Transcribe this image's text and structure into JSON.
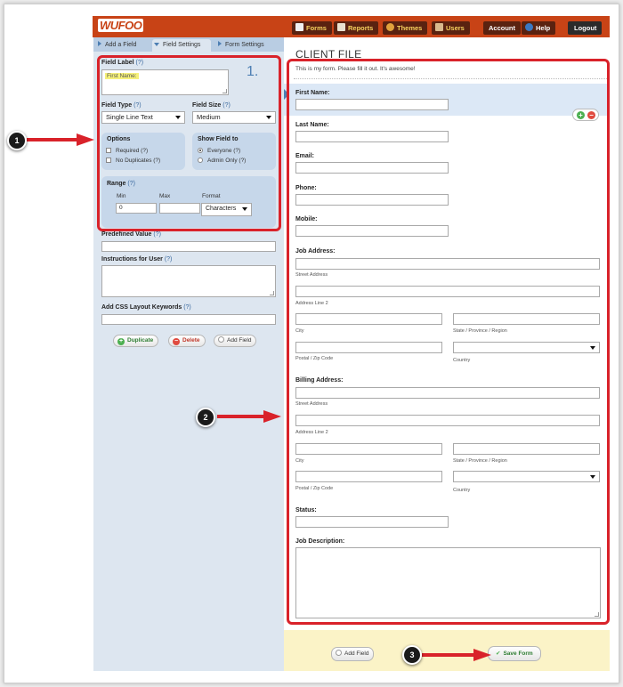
{
  "app": {
    "logo": "WUFOO"
  },
  "nav": {
    "items": [
      {
        "label": "Forms",
        "icon": "forms-icon"
      },
      {
        "label": "Reports",
        "icon": "reports-icon"
      },
      {
        "label": "Themes",
        "icon": "themes-icon"
      },
      {
        "label": "Users",
        "icon": "users-icon"
      }
    ],
    "account": "Account",
    "help": "Help",
    "logout": "Logout"
  },
  "tabs": {
    "add_field": "Add a Field",
    "field_settings": "Field Settings",
    "form_settings": "Form Settings"
  },
  "field_settings": {
    "number": "1.",
    "field_label": {
      "label": "Field Label",
      "help": "(?)",
      "value": "First Name:"
    },
    "field_type": {
      "label": "Field Type",
      "help": "(?)",
      "value": "Single Line Text"
    },
    "field_size": {
      "label": "Field Size",
      "help": "(?)",
      "value": "Medium"
    },
    "options": {
      "label": "Options",
      "required": "Required (?)",
      "no_duplicates": "No Duplicates (?)"
    },
    "show_field": {
      "label": "Show Field to",
      "everyone": "Everyone (?)",
      "admin_only": "Admin Only (?)"
    },
    "range": {
      "label": "Range",
      "help": "(?)",
      "min_label": "Min",
      "max_label": "Max",
      "format_label": "Format",
      "min_value": "0",
      "max_value": "",
      "format_value": "Characters"
    },
    "predefined": {
      "label": "Predefined Value",
      "help": "(?)"
    },
    "instructions": {
      "label": "Instructions for User",
      "help": "(?)"
    },
    "css": {
      "label": "Add CSS Layout Keywords",
      "help": "(?)"
    },
    "buttons": {
      "duplicate": "Duplicate",
      "delete": "Delete",
      "add_field": "Add Field"
    }
  },
  "form": {
    "title": "CLIENT FILE",
    "description": "This is my form. Please fill it out. It's awesome!",
    "first_name": "First Name:",
    "last_name": "Last Name:",
    "email": "Email:",
    "phone": "Phone:",
    "mobile": "Mobile:",
    "job_address": "Job Address:",
    "billing_address": "Billing Address:",
    "street": "Street Address",
    "line2": "Address Line 2",
    "city": "City",
    "state": "State / Province / Region",
    "postal": "Postal / Zip Code",
    "country": "Country",
    "status": "Status:",
    "job_description": "Job Description:"
  },
  "bottom": {
    "add_field": "Add Field",
    "save_form": "Save Form"
  },
  "callouts": [
    "1",
    "2",
    "3"
  ],
  "colors": {
    "brand": "#c84316",
    "annotation": "#d9222a",
    "panel": "#dde6f0"
  }
}
